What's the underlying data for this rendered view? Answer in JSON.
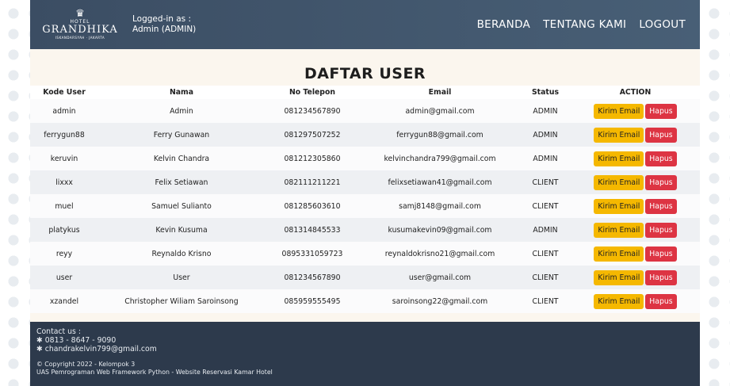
{
  "header": {
    "logo": {
      "top": "HOTEL",
      "brand": "GRANDHIKA",
      "sub": "ISKANDARSYAH · JAKARTA"
    },
    "login_label": "Logged-in as :",
    "login_user": "Admin (ADMIN)",
    "nav": {
      "home": "BERANDA",
      "about": "TENTANG KAMI",
      "logout": "LOGOUT"
    }
  },
  "main": {
    "title": "DAFTAR USER",
    "columns": [
      "Kode User",
      "Nama",
      "No Telepon",
      "Email",
      "Status",
      "ACTION"
    ],
    "action_labels": {
      "email": "Kirim Email",
      "delete": "Hapus"
    },
    "rows": [
      {
        "kode": "admin",
        "nama": "Admin",
        "telp": "081234567890",
        "email": "admin@gmail.com",
        "status": "ADMIN"
      },
      {
        "kode": "ferrygun88",
        "nama": "Ferry Gunawan",
        "telp": "081297507252",
        "email": "ferrygun88@gmail.com",
        "status": "ADMIN"
      },
      {
        "kode": "keruvin",
        "nama": "Kelvin Chandra",
        "telp": "081212305860",
        "email": "kelvinchandra799@gmail.com",
        "status": "ADMIN"
      },
      {
        "kode": "lixxx",
        "nama": "Felix Setiawan",
        "telp": "082111211221",
        "email": "felixsetiawan41@gmail.com",
        "status": "CLIENT"
      },
      {
        "kode": "muel",
        "nama": "Samuel Sulianto",
        "telp": "081285603610",
        "email": "samj8148@gmail.com",
        "status": "CLIENT"
      },
      {
        "kode": "platykus",
        "nama": "Kevin Kusuma",
        "telp": "081314845533",
        "email": "kusumakevin09@gmail.com",
        "status": "ADMIN"
      },
      {
        "kode": "reyy",
        "nama": "Reynaldo Krisno",
        "telp": "0895331059723",
        "email": "reynaldokrisno21@gmail.com",
        "status": "CLIENT"
      },
      {
        "kode": "user",
        "nama": "User",
        "telp": "081234567890",
        "email": "user@gmail.com",
        "status": "CLIENT"
      },
      {
        "kode": "xzandel",
        "nama": "Christopher Wiliam Saroinsong",
        "telp": "085959555495",
        "email": "saroinsong22@gmail.com",
        "status": "CLIENT"
      }
    ]
  },
  "footer": {
    "contact_label": "Contact us :",
    "phone": "✱ 0813 - 8647 - 9090",
    "email": "✱ chandrakelvin799@gmail.com",
    "copyright": "© Copyright 2022 - Kelompok 3",
    "course": "UAS Pemrograman Web Framework Python - Website Reservasi Kamar Hotel"
  },
  "colors": {
    "header_bg": "#3b4d63",
    "footer_bg": "#2d3a4c",
    "email_button": "#f5b800",
    "delete_button": "#dd3443"
  }
}
